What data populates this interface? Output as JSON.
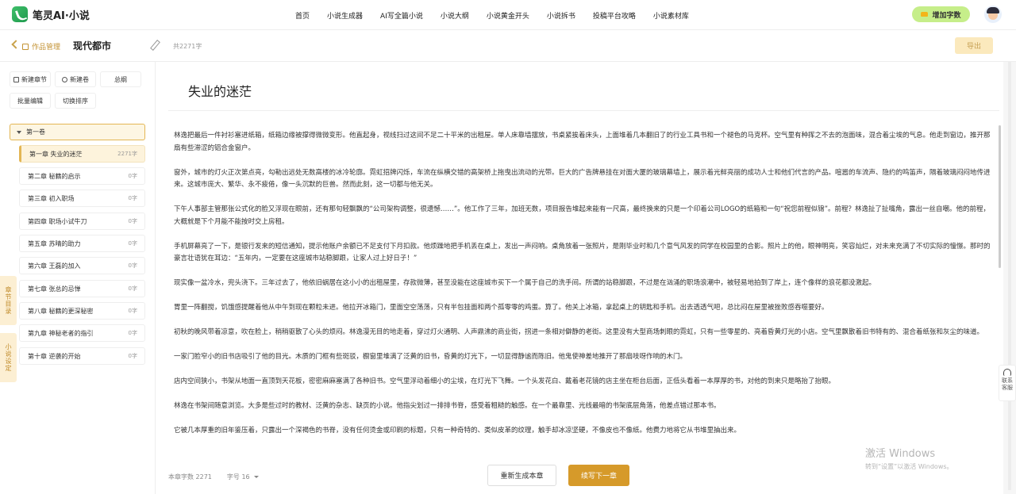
{
  "app": {
    "name": "笔灵AI·小说"
  },
  "nav": [
    "首页",
    "小说生成器",
    "AI写全篇小说",
    "小说大纲",
    "小说黄金开头",
    "小说拆书",
    "投稿平台攻略",
    "小说素材库"
  ],
  "header_actions": {
    "add_words": "增加字数"
  },
  "work": {
    "breadcrumb": "作品管理",
    "title": "现代都市",
    "total_words": "共2271字",
    "export": "导出"
  },
  "toolbar": {
    "new_chapter": "新建章节",
    "new_volume": "新建卷",
    "outline": "总纲",
    "batch_edit": "批量编辑",
    "toggle_sort": "切换排序"
  },
  "volume": {
    "label": "第一卷"
  },
  "chapters": [
    {
      "title": "第一章 失业的迷茫",
      "count": "2271字"
    },
    {
      "title": "第二章 秘籍的启示",
      "count": "0字"
    },
    {
      "title": "第三章 初入职场",
      "count": "0字"
    },
    {
      "title": "第四章 职场小试牛刀",
      "count": "0字"
    },
    {
      "title": "第五章 苏晴的助力",
      "count": "0字"
    },
    {
      "title": "第六章 王磊的加入",
      "count": "0字"
    },
    {
      "title": "第七章 张总的忌惮",
      "count": "0字"
    },
    {
      "title": "第八章 秘籍的更深秘密",
      "count": "0字"
    },
    {
      "title": "第九章 神秘老者的指引",
      "count": "0字"
    },
    {
      "title": "第十章 逆袭的开始",
      "count": "0字"
    }
  ],
  "side_tabs": {
    "toc": "章节目录",
    "settings": "小说设定"
  },
  "editor": {
    "chapter_title": "失业的迷茫",
    "paragraphs": [
      "林逸把最后一件衬衫塞进纸箱，纸箱边缘被撑得微微变形。他直起身，视线扫过这间不足二十平米的出租屋。单人床靠墙摆放，书桌紧挨着床头，上面堆着几本翻旧了的行业工具书和一个褪色的马克杯。空气里有种挥之不去的泡面味，混合着尘埃的气息。他走到窗边，推开那扇有些滞涩的铝合金窗户。",
      "窗外，城市的灯火正次第点亮，勾勒出远处无数高楼的冰冷轮廓。霓虹招牌闪烁，车流在纵横交错的高架桥上拖曳出流动的光带。巨大的广告牌悬挂在对面大厦的玻璃幕墙上，展示着光鲜亮丽的成功人士和他们代言的产品。喧嚣的车流声、隐约的鸣笛声，隔着玻璃闷闷地传进来。这城市庞大、繁华、永不疲倦，像一头沉默的巨兽。然而此刻，这一切都与他无关。",
      "下午人事部主管那张公式化的脸又浮现在眼前，还有那句轻飘飘的“公司架构调整，很遗憾……”。他工作了三年，加班无数，项目报告堆起来能有一尺高，最终换来的只是一个印着公司LOGO的纸箱和一句“祝您前程似锦”。前程？林逸扯了扯嘴角，露出一丝自嘲。他的前程，大概就是下个月能不能按时交上房租。",
      "手机屏幕亮了一下，是银行发来的短信通知，提示他账户余额已不足支付下月扣款。他烦躁地把手机丢在桌上，发出一声闷响。桌角放着一张照片，是刚毕业时和几个意气风发的同学在校园里的合影。照片上的他，眼神明亮，笑容灿烂，对未来充满了不切实际的憧憬。那时的豪言壮语犹在耳边：“五年内，一定要在这座城市站稳脚跟，让家人过上好日子！”",
      "现实像一盆冷水，兜头浇下。三年过去了，他依旧蜗居在这小小的出租屋里，存款微薄，甚至没能在这座城市买下一个属于自己的洗手间。所谓的站稳脚跟，不过是在汹涌的职场浪潮中，被轻易地拍到了岸上，连个像样的浪花都没激起。",
      "胃里一阵翻搅，饥饿感提醒着他从中午到现在颗粒未进。他拉开冰箱门，里面空空荡荡，只有半包挂面和两个孤零零的鸡蛋。算了。他关上冰箱，拿起桌上的钥匙和手机。出去透透气吧，总比闷在屋里被挫败感吞噬要好。",
      "初秋的晚风带着凉意，吹在脸上，稍稍驱散了心头的烦闷。林逸漫无目的地走着，穿过灯火通明、人声鼎沸的商业街，拐进一条相对僻静的老街。这里没有大型商场刺眼的霓虹，只有一些零星的、亮着昏黄灯光的小店。空气里飘散着旧书特有的、混合着纸张和灰尘的味道。",
      "一家门脸窄小的旧书店吸引了他的目光。木质的门框有些斑驳，橱窗里堆满了泛黄的旧书，昏黄的灯光下，一切显得静谧而陈旧。他鬼使神差地推开了那扇吱呀作响的木门。",
      "店内空间狭小，书架从地面一直顶到天花板，密密麻麻塞满了各种旧书。空气里浮动着细小的尘埃，在灯光下飞舞。一个头发花白、戴着老花镜的店主坐在柜台后面，正低头看着一本厚厚的书，对他的到来只是略抬了抬眼。",
      "林逸在书架间随意浏览。大多是些过时的教材、泛黄的杂志、缺页的小说。他指尖划过一排排书脊，感受着粗糙的触感。在一个最靠里、光线最暗的书架底层角落，他差点错过那本书。",
      "它被几本厚重的旧年鉴压着，只露出一个深褐色的书脊，没有任何烫金或印刷的标题，只有一种奇特的、类似皮革的纹理，触手却冰凉坚硬，不像皮也不像纸。他费力地将它从书堆里抽出来。"
    ],
    "chapter_words": "本章字数 2271",
    "font_size": "字号 16",
    "regenerate": "重新生成本章",
    "continue": "续写下一章"
  },
  "support": {
    "contact": "联系客服"
  },
  "watermark": {
    "line1": "激活 Windows",
    "line2": "转到“设置”以激活 Windows。"
  }
}
